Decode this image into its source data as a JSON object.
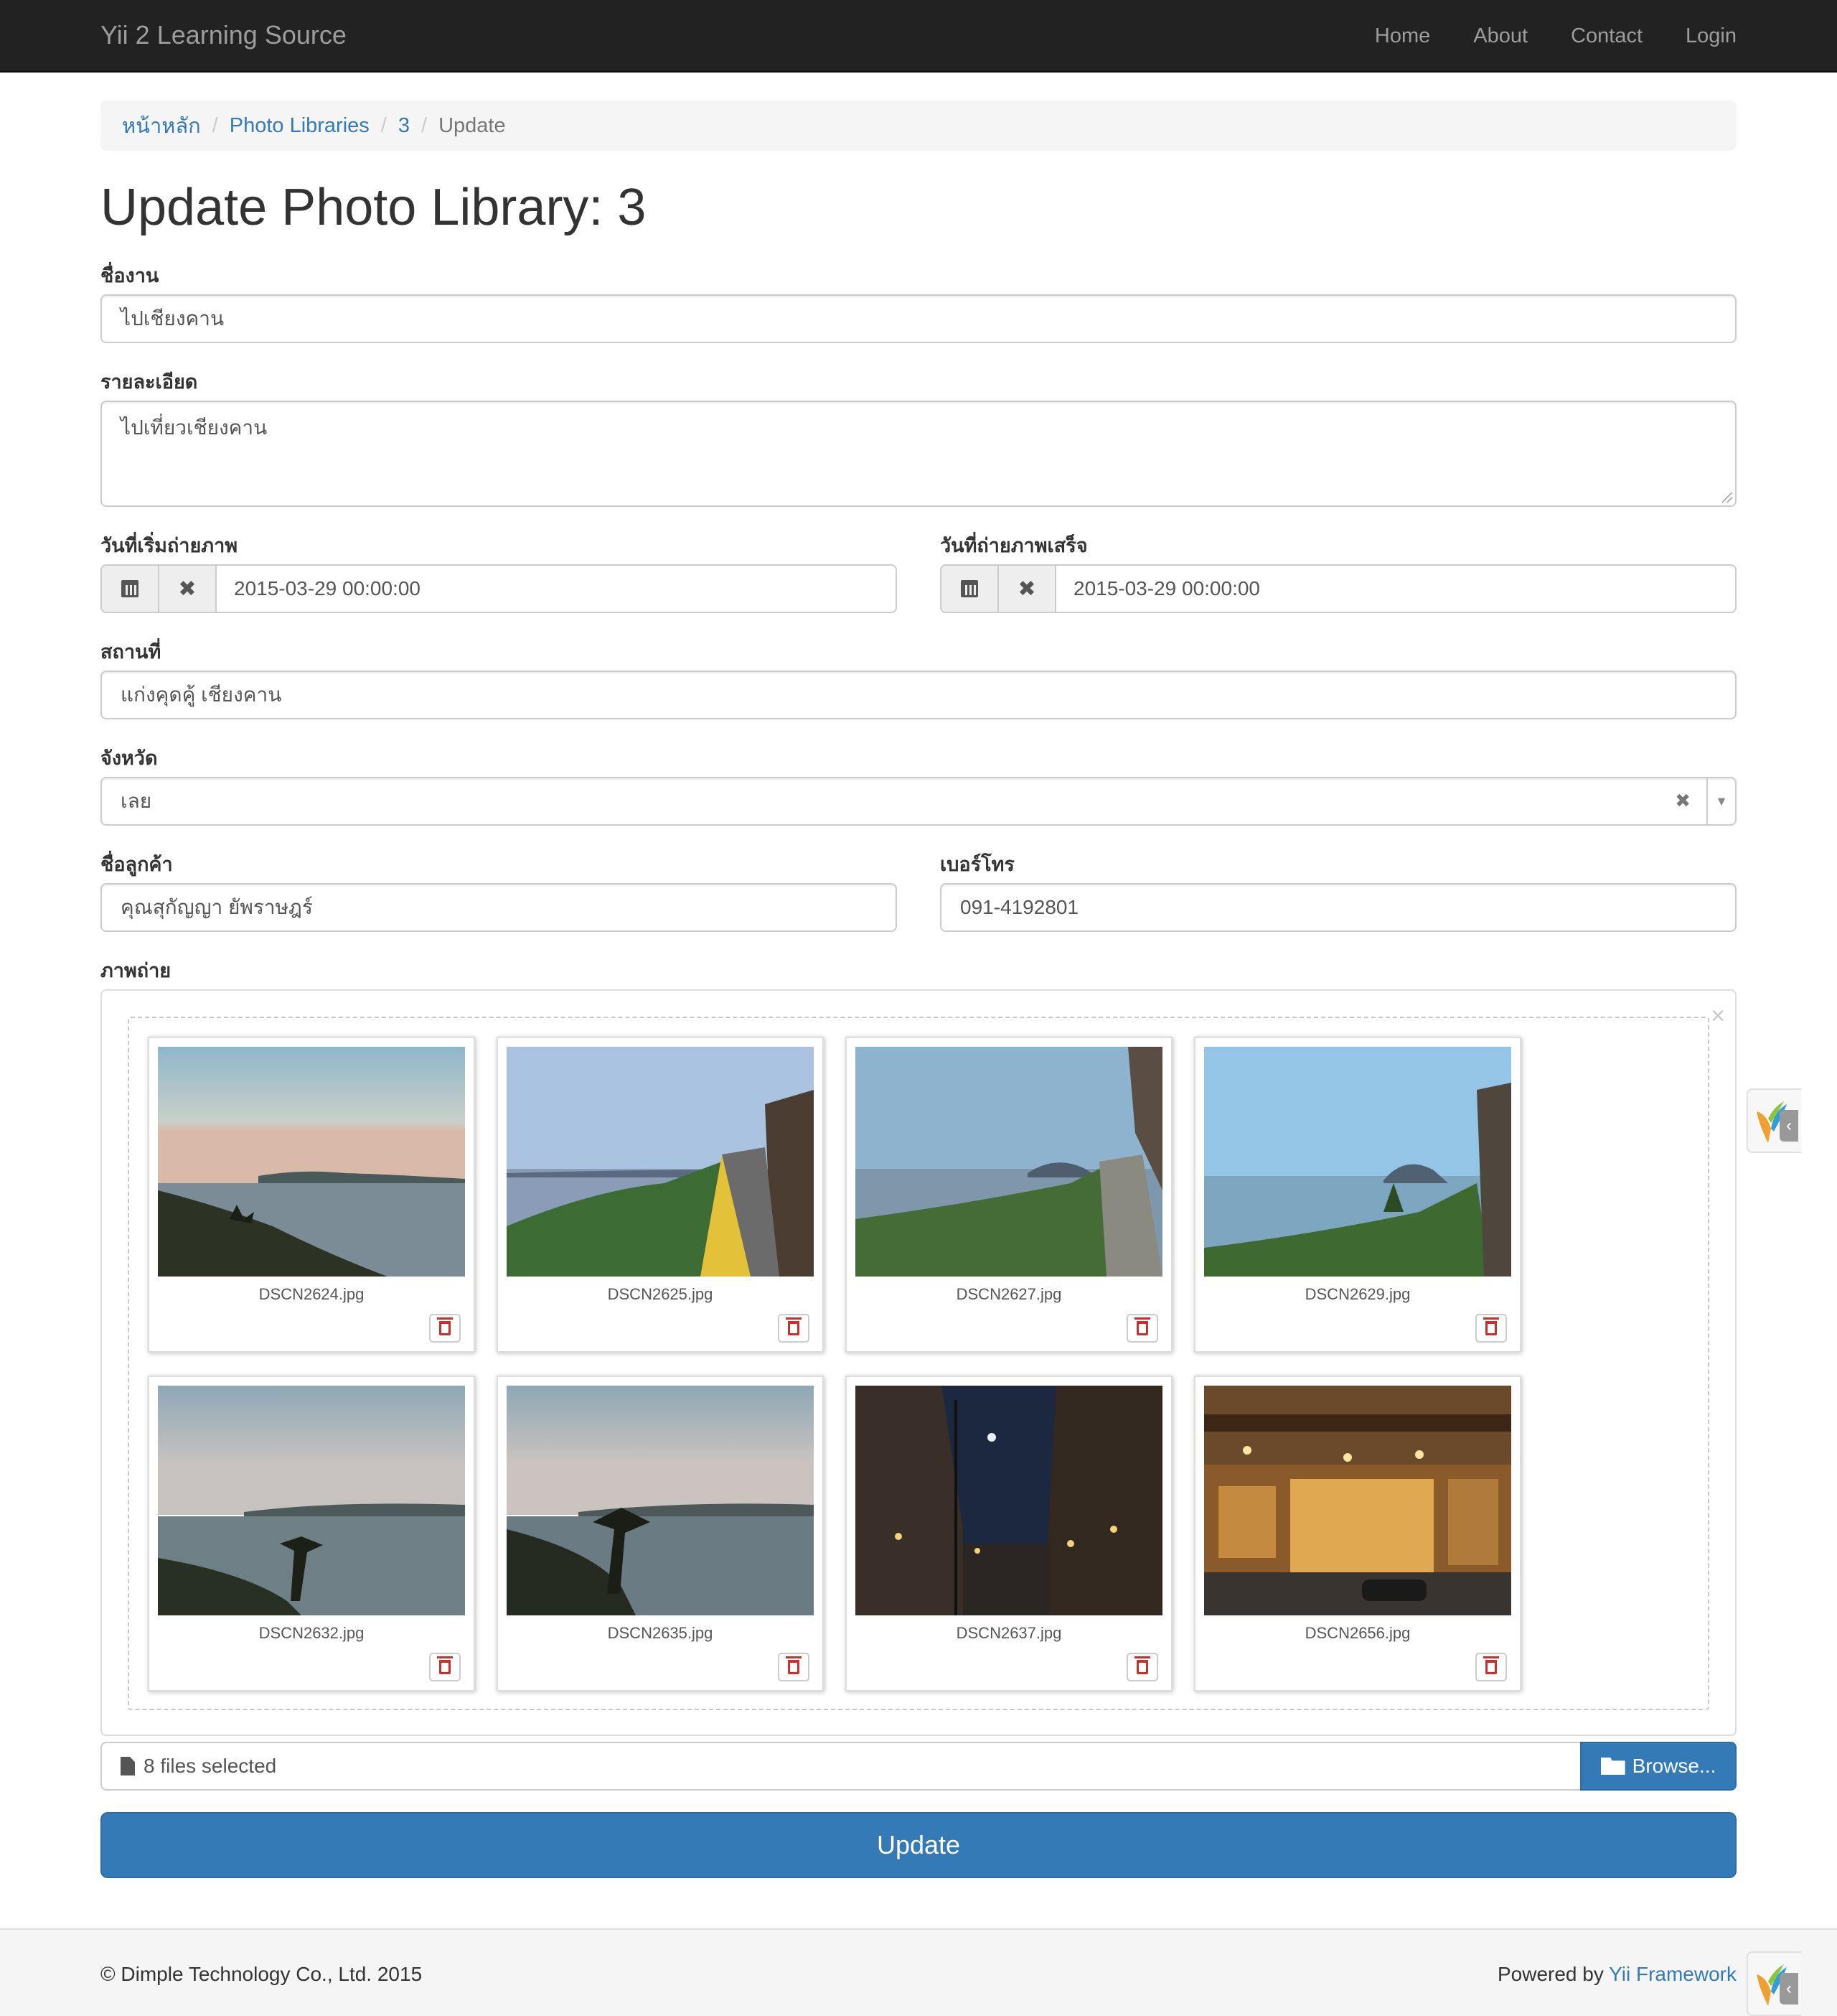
{
  "navbar": {
    "brand": "Yii 2 Learning Source",
    "links": [
      "Home",
      "About",
      "Contact",
      "Login"
    ]
  },
  "breadcrumb": {
    "items": [
      "หน้าหลัก",
      "Photo Libraries",
      "3"
    ],
    "active": "Update",
    "separator": "/"
  },
  "page_title": "Update Photo Library: 3",
  "form": {
    "event_name": {
      "label": "ชื่องาน",
      "value": "ไปเชียงคาน"
    },
    "detail": {
      "label": "รายละเอียด",
      "value": "ไปเที่ยวเชียงคาน"
    },
    "start_date": {
      "label": "วันที่เริ่มถ่ายภาพ",
      "value": "2015-03-29 00:00:00"
    },
    "end_date": {
      "label": "วันที่ถ่ายภาพเสร็จ",
      "value": "2015-03-29 00:00:00"
    },
    "location": {
      "label": "สถานที่",
      "value": "แก่งคุดคู้ เชียงคาน"
    },
    "province": {
      "label": "จังหวัด",
      "value": "เลย"
    },
    "customer": {
      "label": "ชื่อลูกค้า",
      "value": "คุณสุกัญญา ยัพราษฎร์"
    },
    "phone": {
      "label": "เบอร์โทร",
      "value": "091-4192801"
    },
    "photos": {
      "label": "ภาพถ่าย"
    }
  },
  "gallery": {
    "files": [
      {
        "name": "DSCN2624.jpg",
        "scene": "river-dusk"
      },
      {
        "name": "DSCN2625.jpg",
        "scene": "river-walkway-yellow-chairs"
      },
      {
        "name": "DSCN2627.jpg",
        "scene": "river-bank-path"
      },
      {
        "name": "DSCN2629.jpg",
        "scene": "river-bank-tree"
      },
      {
        "name": "DSCN2632.jpg",
        "scene": "river-silhouette-tree"
      },
      {
        "name": "DSCN2635.jpg",
        "scene": "river-silhouette-tree-2"
      },
      {
        "name": "DSCN2637.jpg",
        "scene": "night-street"
      },
      {
        "name": "DSCN2656.jpg",
        "scene": "night-shopfront"
      }
    ]
  },
  "file_input": {
    "caption": "8 files selected",
    "browse_label": "Browse..."
  },
  "submit_label": "Update",
  "footer": {
    "copyright": "© Dimple Technology Co., Ltd. 2015",
    "powered_prefix": "Powered by",
    "powered_link": "Yii Framework"
  },
  "colors": {
    "navbar_bg": "#222222",
    "primary": "#337ab7",
    "danger": "#d9534f"
  }
}
